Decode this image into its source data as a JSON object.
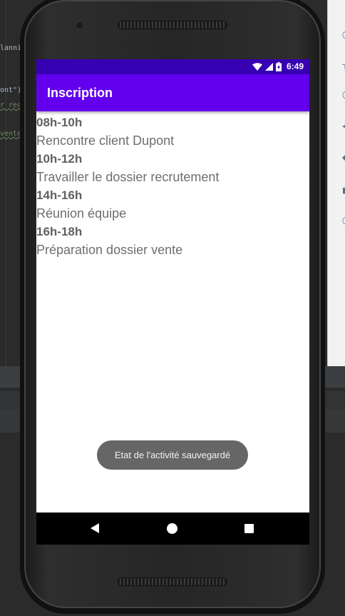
{
  "ide": {
    "code_fragments": [
      "lanni",
      "ont\")",
      "r rec",
      "vente"
    ]
  },
  "status_bar": {
    "time": "6:49",
    "icons": [
      "wifi-icon",
      "signal-icon",
      "battery-icon"
    ]
  },
  "app_bar": {
    "title": "Inscription"
  },
  "schedule": [
    {
      "time": "08h-10h",
      "description": "Rencontre client Dupont"
    },
    {
      "time": "10h-12h",
      "description": "Travailler le dossier recrutement"
    },
    {
      "time": "14h-16h",
      "description": "Réunion équipe"
    },
    {
      "time": "16h-18h",
      "description": "Préparation dossier vente"
    }
  ],
  "toast": {
    "message": "Etat de l'activité sauvegardé"
  },
  "nav_bar": {
    "icons": [
      "back-icon",
      "home-icon",
      "recents-icon"
    ]
  },
  "colors": {
    "status_bar": "#3700b3",
    "app_bar": "#6200ee"
  }
}
